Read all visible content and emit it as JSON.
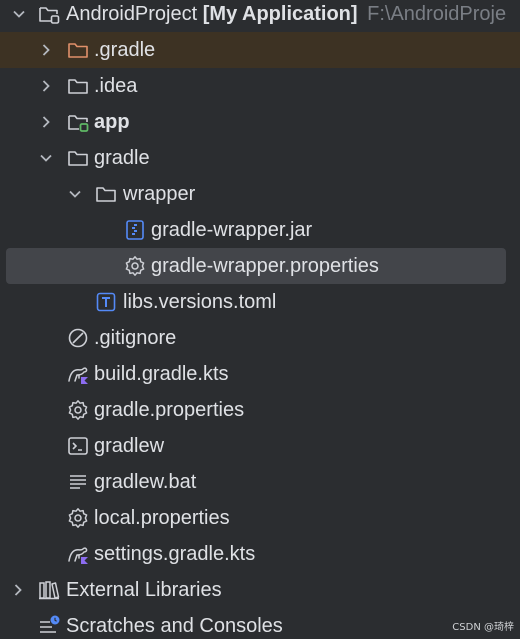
{
  "project": {
    "name": "AndroidProject",
    "module": "[My Application]",
    "path": "F:\\AndroidProje"
  },
  "tree": {
    "gradle_hidden": ".gradle",
    "idea": ".idea",
    "app": "app",
    "gradle_dir": "gradle",
    "wrapper": "wrapper",
    "wrapper_jar": "gradle-wrapper.jar",
    "wrapper_props": "gradle-wrapper.properties",
    "libs_versions": "libs.versions.toml",
    "gitignore": ".gitignore",
    "build_gradle": "build.gradle.kts",
    "gradle_props": "gradle.properties",
    "gradlew": "gradlew",
    "gradlew_bat": "gradlew.bat",
    "local_props": "local.properties",
    "settings_gradle": "settings.gradle.kts",
    "external_libs": "External Libraries",
    "scratches": "Scratches and Consoles"
  },
  "watermark": "CSDN @琦梓",
  "colors": {
    "background": "#2b2d30",
    "text": "#dfe1e5",
    "muted": "#7a7e85",
    "selected_row": "#43454a",
    "excluded_row": "#3d3223",
    "excluded_folder": "#e0906a",
    "module_badge": "#5fb865",
    "file_blue": "#548af7"
  }
}
